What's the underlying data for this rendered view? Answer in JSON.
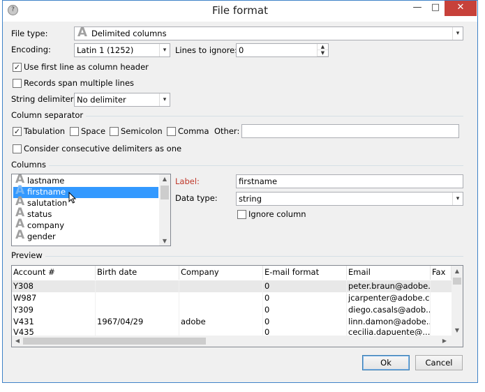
{
  "window": {
    "title": "File format",
    "minimize_glyph": "—",
    "maximize_glyph": "□",
    "close_glyph": "✕"
  },
  "file_type": {
    "label": "File type:",
    "value": "Delimited columns"
  },
  "encoding": {
    "label": "Encoding:",
    "value": "Latin 1 (1252)"
  },
  "lines_to_ignore": {
    "label": "Lines to ignore:",
    "value": "0"
  },
  "options": {
    "first_line_header": {
      "label": "Use first line as column header",
      "checked": true
    },
    "span_lines": {
      "label": "Records span multiple lines",
      "checked": false
    }
  },
  "string_delimiter": {
    "label": "String delimiter:",
    "value": "No delimiter"
  },
  "column_separator": {
    "section_label": "Column separator",
    "tabulation": {
      "label": "Tabulation",
      "checked": true
    },
    "space": {
      "label": "Space",
      "checked": false
    },
    "semicolon": {
      "label": "Semicolon",
      "checked": false
    },
    "comma": {
      "label": "Comma",
      "checked": false
    },
    "other_label": "Other:",
    "other_value": "",
    "consecutive": {
      "label": "Consider consecutive delimiters as one",
      "checked": false
    }
  },
  "columns": {
    "section_label": "Columns",
    "items": [
      "lastname",
      "firstname",
      "salutation",
      "status",
      "company",
      "gender"
    ],
    "selected": "firstname",
    "label_caption": "Label:",
    "label_value": "firstname",
    "datatype_caption": "Data type:",
    "datatype_value": "string",
    "ignore_column": {
      "label": "Ignore column",
      "checked": false
    }
  },
  "preview": {
    "section_label": "Preview",
    "headers": [
      "Account #",
      "Birth date",
      "Company",
      "E-mail format",
      "Email",
      "Fax"
    ],
    "rows": [
      [
        "Y308",
        "",
        "",
        "0",
        "peter.braun@adobe...."
      ],
      [
        "W987",
        "",
        "",
        "0",
        "jcarpenter@adobe.c..."
      ],
      [
        "Y309",
        "",
        "",
        "0",
        "diego.casals@adob..."
      ],
      [
        "V431",
        "1967/04/29",
        "adobe",
        "0",
        "linn.damon@adobe...."
      ],
      [
        "V435",
        "",
        "",
        "0",
        "cecilia.dapuente@..."
      ]
    ]
  },
  "buttons": {
    "ok": "Ok",
    "cancel": "Cancel"
  },
  "icons": {
    "text_type_glyph": "A",
    "dropdown_glyph": "▾",
    "check_glyph": "✓",
    "up_glyph": "▲",
    "down_glyph": "▼",
    "left_glyph": "◀",
    "right_glyph": "▶"
  },
  "colors": {
    "selection": "#3399ff",
    "label_accent": "#c0392b",
    "close_button": "#c7413a",
    "window_border": "#3e82c8"
  }
}
